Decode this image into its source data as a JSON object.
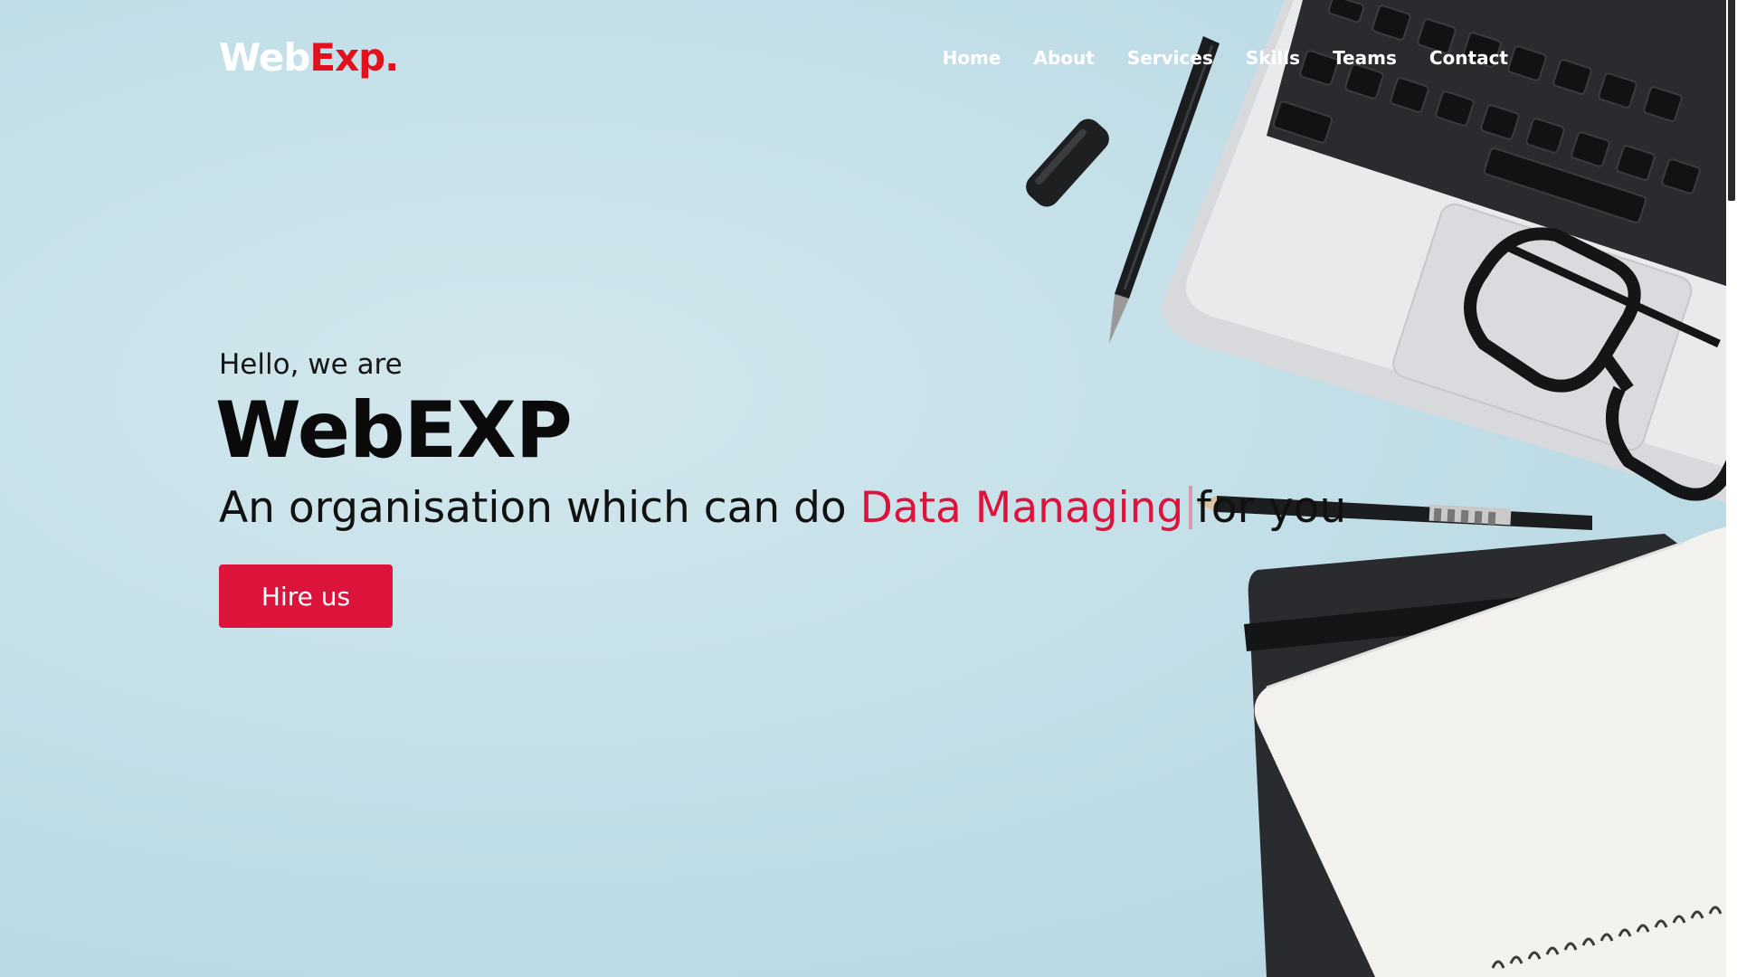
{
  "navbar": {
    "logo_part1": "Web",
    "logo_part2": "Exp.",
    "links": [
      "Home",
      "About",
      "Services",
      "Skills",
      "Teams",
      "Contact"
    ]
  },
  "hero": {
    "greeting": "Hello, we are",
    "title": "WebEXP",
    "tagline_prefix": "An organisation which can do",
    "tagline_typed": "Data Managing",
    "tagline_suffix": "for you",
    "button_label": "Hire us"
  },
  "colors": {
    "accent": "#dc143c",
    "logo_accent": "#e3101e",
    "background": "#c3dfe8"
  },
  "icons": [
    "laptop-image",
    "eyeglasses-image",
    "pen-image",
    "pencil-image",
    "notebook-image"
  ]
}
